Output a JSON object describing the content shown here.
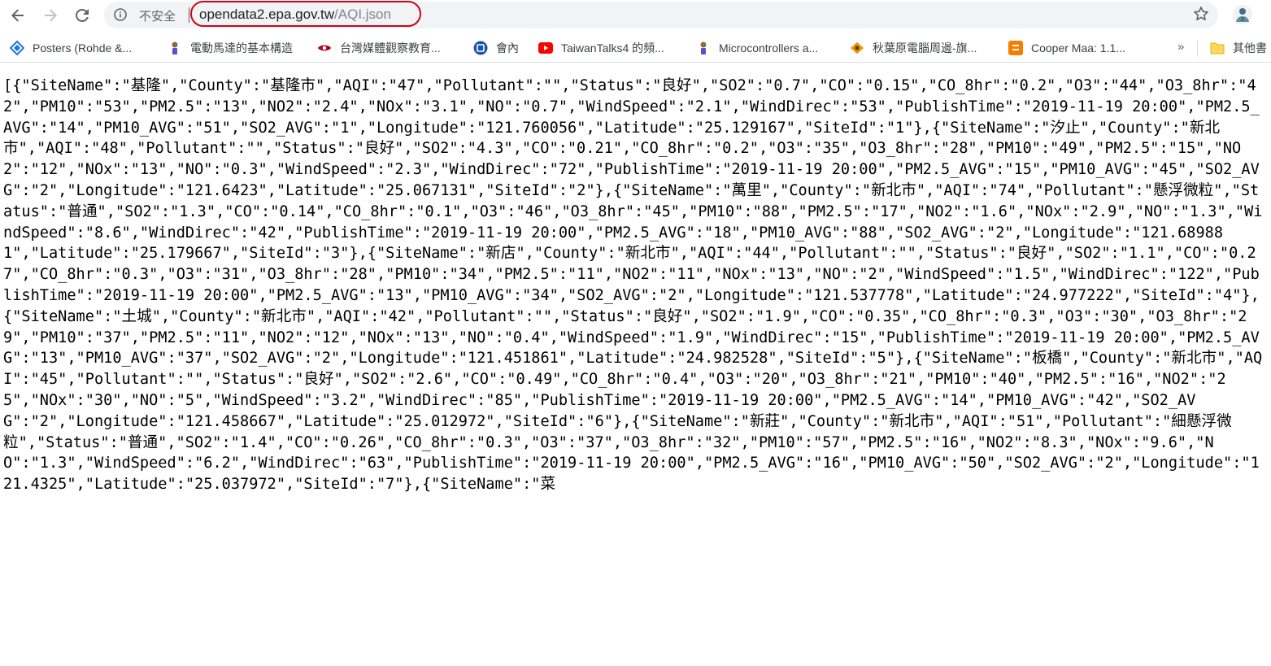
{
  "browser": {
    "back_icon": "arrow-left-icon",
    "forward_icon": "arrow-right-icon",
    "reload_icon": "reload-icon",
    "security_label": "不安全",
    "url_host": "opendata2.epa.gov.tw",
    "url_path": "/AQI.json",
    "star_icon": "star-icon",
    "annotation_color": "#d0021b"
  },
  "bookmarks": {
    "items": [
      {
        "label": "Posters (Rohde &...",
        "icon": "rohde-logo-icon"
      },
      {
        "label": "電動馬達的基本構造",
        "icon": "page-icon"
      },
      {
        "label": "台灣媒體觀察教育...",
        "icon": "eye-logo-icon"
      },
      {
        "label": "會內",
        "icon": "blue-circle-icon"
      },
      {
        "label": "TaiwanTalks4 的頻...",
        "icon": "youtube-icon"
      },
      {
        "label": "Microcontrollers a...",
        "icon": "page-icon"
      },
      {
        "label": "秋葉原電腦周邊-旗...",
        "icon": "orange-logo-icon"
      },
      {
        "label": "Cooper Maa: 1.1...",
        "icon": "blogger-icon"
      }
    ],
    "overflow_label": "»",
    "other_label": "其他書"
  },
  "json_text": "[{\"SiteName\":\"基隆\",\"County\":\"基隆市\",\"AQI\":\"47\",\"Pollutant\":\"\",\"Status\":\"良好\",\"SO2\":\"0.7\",\"CO\":\"0.15\",\"CO_8hr\":\"0.2\",\"O3\":\"44\",\"O3_8hr\":\"42\",\"PM10\":\"53\",\"PM2.5\":\"13\",\"NO2\":\"2.4\",\"NOx\":\"3.1\",\"NO\":\"0.7\",\"WindSpeed\":\"2.1\",\"WindDirec\":\"53\",\"PublishTime\":\"2019-11-19 20:00\",\"PM2.5_AVG\":\"14\",\"PM10_AVG\":\"51\",\"SO2_AVG\":\"1\",\"Longitude\":\"121.760056\",\"Latitude\":\"25.129167\",\"SiteId\":\"1\"},{\"SiteName\":\"汐止\",\"County\":\"新北市\",\"AQI\":\"48\",\"Pollutant\":\"\",\"Status\":\"良好\",\"SO2\":\"4.3\",\"CO\":\"0.21\",\"CO_8hr\":\"0.2\",\"O3\":\"35\",\"O3_8hr\":\"28\",\"PM10\":\"49\",\"PM2.5\":\"15\",\"NO2\":\"12\",\"NOx\":\"13\",\"NO\":\"0.3\",\"WindSpeed\":\"2.3\",\"WindDirec\":\"72\",\"PublishTime\":\"2019-11-19 20:00\",\"PM2.5_AVG\":\"15\",\"PM10_AVG\":\"45\",\"SO2_AVG\":\"2\",\"Longitude\":\"121.6423\",\"Latitude\":\"25.067131\",\"SiteId\":\"2\"},{\"SiteName\":\"萬里\",\"County\":\"新北市\",\"AQI\":\"74\",\"Pollutant\":\"懸浮微粒\",\"Status\":\"普通\",\"SO2\":\"1.3\",\"CO\":\"0.14\",\"CO_8hr\":\"0.1\",\"O3\":\"46\",\"O3_8hr\":\"45\",\"PM10\":\"88\",\"PM2.5\":\"17\",\"NO2\":\"1.6\",\"NOx\":\"2.9\",\"NO\":\"1.3\",\"WindSpeed\":\"8.6\",\"WindDirec\":\"42\",\"PublishTime\":\"2019-11-19 20:00\",\"PM2.5_AVG\":\"18\",\"PM10_AVG\":\"88\",\"SO2_AVG\":\"2\",\"Longitude\":\"121.689881\",\"Latitude\":\"25.179667\",\"SiteId\":\"3\"},{\"SiteName\":\"新店\",\"County\":\"新北市\",\"AQI\":\"44\",\"Pollutant\":\"\",\"Status\":\"良好\",\"SO2\":\"1.1\",\"CO\":\"0.27\",\"CO_8hr\":\"0.3\",\"O3\":\"31\",\"O3_8hr\":\"28\",\"PM10\":\"34\",\"PM2.5\":\"11\",\"NO2\":\"11\",\"NOx\":\"13\",\"NO\":\"2\",\"WindSpeed\":\"1.5\",\"WindDirec\":\"122\",\"PublishTime\":\"2019-11-19 20:00\",\"PM2.5_AVG\":\"13\",\"PM10_AVG\":\"34\",\"SO2_AVG\":\"2\",\"Longitude\":\"121.537778\",\"Latitude\":\"24.977222\",\"SiteId\":\"4\"},{\"SiteName\":\"土城\",\"County\":\"新北市\",\"AQI\":\"42\",\"Pollutant\":\"\",\"Status\":\"良好\",\"SO2\":\"1.9\",\"CO\":\"0.35\",\"CO_8hr\":\"0.3\",\"O3\":\"30\",\"O3_8hr\":\"29\",\"PM10\":\"37\",\"PM2.5\":\"11\",\"NO2\":\"12\",\"NOx\":\"13\",\"NO\":\"0.4\",\"WindSpeed\":\"1.9\",\"WindDirec\":\"15\",\"PublishTime\":\"2019-11-19 20:00\",\"PM2.5_AVG\":\"13\",\"PM10_AVG\":\"37\",\"SO2_AVG\":\"2\",\"Longitude\":\"121.451861\",\"Latitude\":\"24.982528\",\"SiteId\":\"5\"},{\"SiteName\":\"板橋\",\"County\":\"新北市\",\"AQI\":\"45\",\"Pollutant\":\"\",\"Status\":\"良好\",\"SO2\":\"2.6\",\"CO\":\"0.49\",\"CO_8hr\":\"0.4\",\"O3\":\"20\",\"O3_8hr\":\"21\",\"PM10\":\"40\",\"PM2.5\":\"16\",\"NO2\":\"25\",\"NOx\":\"30\",\"NO\":\"5\",\"WindSpeed\":\"3.2\",\"WindDirec\":\"85\",\"PublishTime\":\"2019-11-19 20:00\",\"PM2.5_AVG\":\"14\",\"PM10_AVG\":\"42\",\"SO2_AVG\":\"2\",\"Longitude\":\"121.458667\",\"Latitude\":\"25.012972\",\"SiteId\":\"6\"},{\"SiteName\":\"新莊\",\"County\":\"新北市\",\"AQI\":\"51\",\"Pollutant\":\"細懸浮微粒\",\"Status\":\"普通\",\"SO2\":\"1.4\",\"CO\":\"0.26\",\"CO_8hr\":\"0.3\",\"O3\":\"37\",\"O3_8hr\":\"32\",\"PM10\":\"57\",\"PM2.5\":\"16\",\"NO2\":\"8.3\",\"NOx\":\"9.6\",\"NO\":\"1.3\",\"WindSpeed\":\"6.2\",\"WindDirec\":\"63\",\"PublishTime\":\"2019-11-19 20:00\",\"PM2.5_AVG\":\"16\",\"PM10_AVG\":\"50\",\"SO2_AVG\":\"2\",\"Longitude\":\"121.4325\",\"Latitude\":\"25.037972\",\"SiteId\":\"7\"},{\"SiteName\":\"菜"
}
